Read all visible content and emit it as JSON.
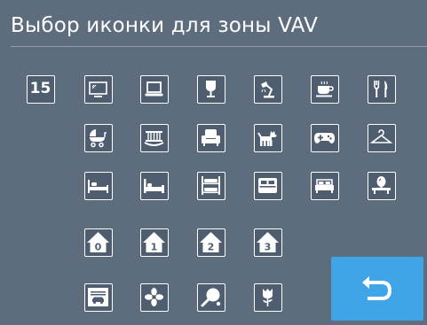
{
  "window": {
    "title": "Выбор иконки для зоны VAV"
  },
  "icons": [
    {
      "label": "15",
      "icon": "number-15-icon"
    },
    {
      "icon": "tv-icon"
    },
    {
      "icon": "laptop-icon"
    },
    {
      "icon": "wine-glass-icon"
    },
    {
      "icon": "desk-lamp-icon"
    },
    {
      "icon": "coffee-cup-icon"
    },
    {
      "icon": "fork-knife-icon"
    },
    {
      "icon": "baby-stroller-icon"
    },
    {
      "icon": "crib-icon"
    },
    {
      "icon": "armchair-icon"
    },
    {
      "icon": "dog-icon"
    },
    {
      "icon": "gamepad-icon"
    },
    {
      "icon": "hanger-icon"
    },
    {
      "icon": "single-bed-icon"
    },
    {
      "icon": "bed-icon"
    },
    {
      "icon": "bunk-bed-icon"
    },
    {
      "icon": "double-bed-front-icon"
    },
    {
      "icon": "double-bed-icon"
    },
    {
      "icon": "vanity-mirror-icon"
    },
    {
      "label": "0",
      "icon": "house-floor-0-icon"
    },
    {
      "label": "1",
      "icon": "house-floor-1-icon"
    },
    {
      "label": "2",
      "icon": "house-floor-2-icon"
    },
    {
      "label": "3",
      "icon": "house-floor-3-icon"
    },
    {
      "icon": "garage-car-icon"
    },
    {
      "icon": "fan-icon"
    },
    {
      "icon": "ping-pong-icon"
    },
    {
      "icon": "flower-icon"
    }
  ],
  "back_button": {
    "icon": "back-arrow-icon"
  },
  "colors": {
    "background": "#5d6d7e",
    "tile_border": "#ffffff",
    "back_button": "#3fa5e6"
  }
}
